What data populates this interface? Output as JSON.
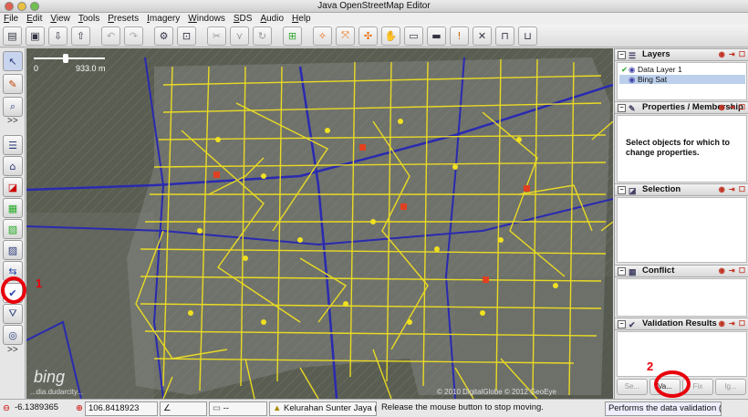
{
  "window": {
    "title": "Java OpenStreetMap Editor"
  },
  "menu": [
    "File",
    "Edit",
    "View",
    "Tools",
    "Presets",
    "Imagery",
    "Windows",
    "SDS",
    "Audio",
    "Help"
  ],
  "toolbar": {
    "icons": [
      "open-icon",
      "save-icon",
      "download-icon",
      "upload-icon",
      "undo-icon",
      "redo-icon",
      "preferences-icon",
      "zoom-icon",
      "split-way-icon",
      "combine-way-icon",
      "refresh-icon",
      "orthogonalize-icon",
      "align-circle-icon",
      "simplify-icon",
      "reverse-icon",
      "hand-icon",
      "car-icon",
      "bus-icon",
      "info-icon",
      "delete-icon",
      "bridge-icon",
      "tunnel-icon"
    ]
  },
  "left_toolbar": {
    "more_label_1": ">>",
    "more_label_2": ">>"
  },
  "map": {
    "scale_zero": "0",
    "scale_value": "933.0 m",
    "bing_logo": "bing",
    "attribution": "...dia.dudarcity...",
    "copyright": "© 2010 DigitalGlobe  © 2012 GeoEye"
  },
  "panels": {
    "layers": {
      "title": "Layers",
      "items": [
        {
          "name": "Data Layer 1"
        },
        {
          "name": "Bing Sat"
        }
      ]
    },
    "properties": {
      "title": "Properties / Membership",
      "hint": "Select objects for which to change properties."
    },
    "selection": {
      "title": "Selection"
    },
    "conflict": {
      "title": "Conflict"
    },
    "validation": {
      "title": "Validation Results",
      "buttons": [
        "Se...",
        "Va...",
        "Fix",
        "Ig..."
      ]
    }
  },
  "status": {
    "lat": "-6.1389365",
    "lon": "106.8418923",
    "heading": "",
    "distance": "--",
    "name": "Kelurahan Sunter Jaya (...",
    "message": "Release the mouse button to stop moving.",
    "action": "Performs the data validation (O+V)"
  },
  "annotations": {
    "marker1": "1",
    "marker2": "2"
  },
  "colors": {
    "data_yellow": "#f0e020",
    "highlight_red": "#e8000b",
    "road_blue": "#2a2ab0"
  }
}
